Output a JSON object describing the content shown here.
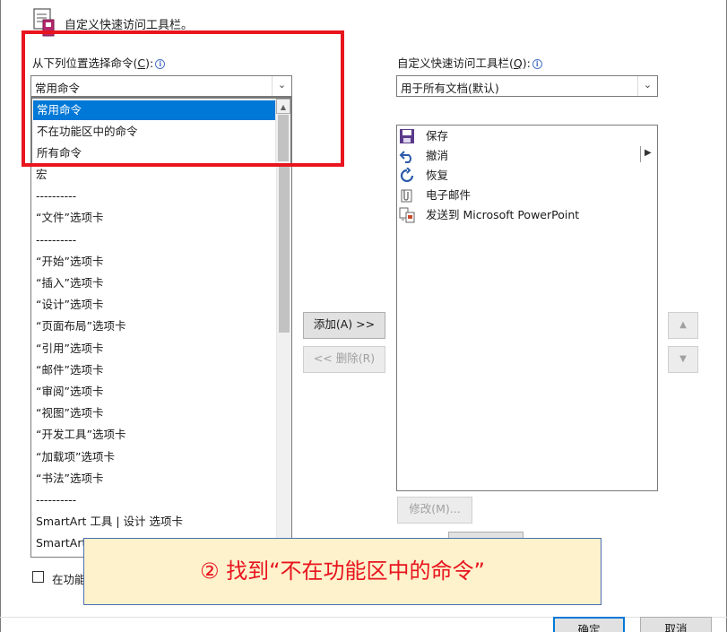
{
  "header": {
    "title": "自定义快速访问工具栏。"
  },
  "left": {
    "label": "从下列位置选择命令(",
    "label_key": "C",
    "label_end": "):",
    "selected": "常用命令",
    "dropdown_options": [
      "常用命令",
      "不在功能区中的命令",
      "所有命令"
    ],
    "dropdown_selected_index": 0,
    "list_items": [
      "宏",
      "----------",
      "“文件”选项卡",
      "----------",
      "“开始”选项卡",
      "“插入”选项卡",
      "“设计”选项卡",
      "“页面布局”选项卡",
      "“引用”选项卡",
      "“邮件”选项卡",
      "“审阅”选项卡",
      "“视图”选项卡",
      "“开发工具”选项卡",
      "“加载项”选项卡",
      "“书法”选项卡",
      "----------",
      "SmartArt 工具 | 设计 选项卡",
      "SmartArt"
    ]
  },
  "right": {
    "label": "自定义快速访问工具栏(",
    "label_key": "Q",
    "label_end": "):",
    "selected": "用于所有文档(默认)",
    "items": [
      {
        "label": "保存",
        "icon": "save-icon"
      },
      {
        "label": "撤消",
        "icon": "undo-icon"
      },
      {
        "label": "恢复",
        "icon": "redo-icon"
      },
      {
        "label": "电子邮件",
        "icon": "email-icon"
      },
      {
        "label": "发送到 Microsoft PowerPoint",
        "icon": "send-to-powerpoint-icon"
      }
    ]
  },
  "buttons": {
    "add": "添加(A) >>",
    "remove": "<< 删除(R)",
    "modify": "修改(M)...",
    "ok": "确定",
    "cancel": "取消"
  },
  "checkbox": {
    "label": "在功能"
  },
  "callout": {
    "text": "② 找到“不在功能区中的命令”"
  },
  "colors": {
    "highlight": "#e8141e",
    "selection": "#0078d7",
    "callout_bg": "#fdf2cc"
  }
}
